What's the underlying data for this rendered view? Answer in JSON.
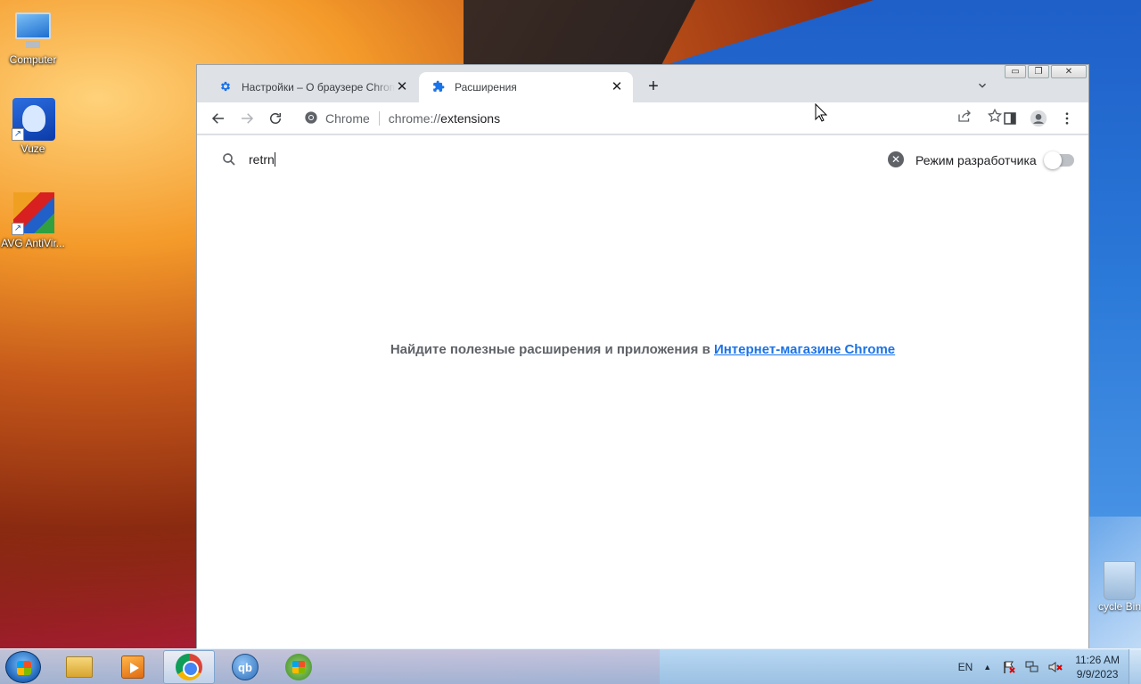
{
  "desktop": {
    "icons": [
      {
        "label": "Computer",
        "icon": "computer-icon"
      },
      {
        "label": "Vuze",
        "icon": "vuze-icon"
      },
      {
        "label": "AVG AntiVir...",
        "icon": "avg-icon"
      }
    ],
    "recycle_bin": {
      "label": "cycle Bin",
      "icon": "recycle-bin-icon"
    }
  },
  "browser": {
    "window_controls": {
      "minimize": "▭",
      "maximize": "❐",
      "close": "✕"
    },
    "tabs": [
      {
        "title": "Настройки – О браузере Chrome",
        "icon": "gear-icon",
        "active": false
      },
      {
        "title": "Расширения",
        "icon": "puzzle-icon",
        "active": true
      }
    ],
    "new_tab": "+",
    "toolbar": {
      "origin_chip": "Chrome",
      "url_scheme": "chrome://",
      "url_path": "extensions"
    },
    "extensions_page": {
      "search_value": "retrn",
      "dev_mode_label": "Режим разработчика",
      "dev_mode_on": false,
      "empty_message": "Найдите полезные расширения и приложения в",
      "store_link": "Интернет-магазине Chrome"
    }
  },
  "taskbar": {
    "apps": [
      {
        "name": "explorer",
        "icon": "folder-icon",
        "active": false
      },
      {
        "name": "media-player",
        "icon": "media-player-icon",
        "active": false
      },
      {
        "name": "chrome",
        "icon": "chrome-icon",
        "active": true
      },
      {
        "name": "qbittorrent",
        "icon": "qbittorrent-icon",
        "label": "qb",
        "active": false
      },
      {
        "name": "windows",
        "icon": "windows-icon",
        "active": false
      }
    ],
    "tray": {
      "language": "EN",
      "time": "11:26 AM",
      "date": "9/9/2023"
    }
  }
}
